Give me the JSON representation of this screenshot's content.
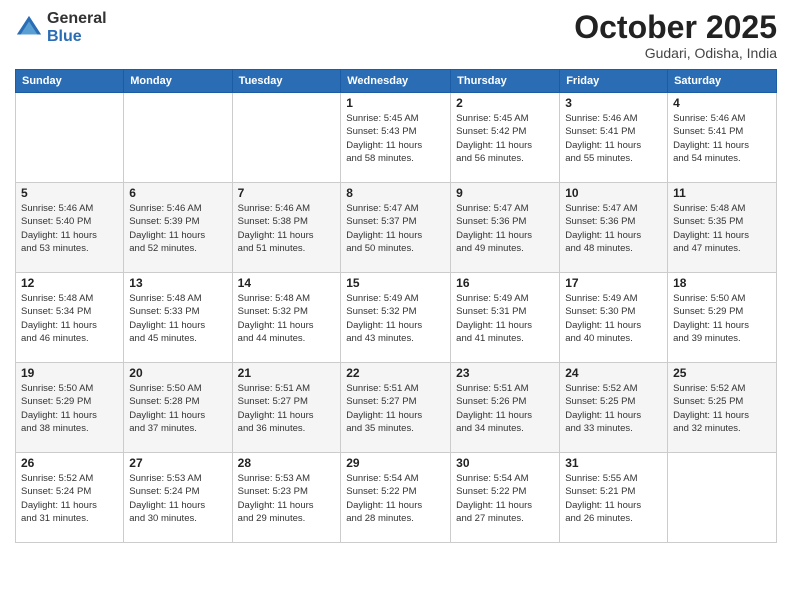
{
  "header": {
    "logo_general": "General",
    "logo_blue": "Blue",
    "month_title": "October 2025",
    "location": "Gudari, Odisha, India"
  },
  "weekdays": [
    "Sunday",
    "Monday",
    "Tuesday",
    "Wednesday",
    "Thursday",
    "Friday",
    "Saturday"
  ],
  "weeks": [
    [
      {
        "day": "",
        "info": ""
      },
      {
        "day": "",
        "info": ""
      },
      {
        "day": "",
        "info": ""
      },
      {
        "day": "1",
        "info": "Sunrise: 5:45 AM\nSunset: 5:43 PM\nDaylight: 11 hours\nand 58 minutes."
      },
      {
        "day": "2",
        "info": "Sunrise: 5:45 AM\nSunset: 5:42 PM\nDaylight: 11 hours\nand 56 minutes."
      },
      {
        "day": "3",
        "info": "Sunrise: 5:46 AM\nSunset: 5:41 PM\nDaylight: 11 hours\nand 55 minutes."
      },
      {
        "day": "4",
        "info": "Sunrise: 5:46 AM\nSunset: 5:41 PM\nDaylight: 11 hours\nand 54 minutes."
      }
    ],
    [
      {
        "day": "5",
        "info": "Sunrise: 5:46 AM\nSunset: 5:40 PM\nDaylight: 11 hours\nand 53 minutes."
      },
      {
        "day": "6",
        "info": "Sunrise: 5:46 AM\nSunset: 5:39 PM\nDaylight: 11 hours\nand 52 minutes."
      },
      {
        "day": "7",
        "info": "Sunrise: 5:46 AM\nSunset: 5:38 PM\nDaylight: 11 hours\nand 51 minutes."
      },
      {
        "day": "8",
        "info": "Sunrise: 5:47 AM\nSunset: 5:37 PM\nDaylight: 11 hours\nand 50 minutes."
      },
      {
        "day": "9",
        "info": "Sunrise: 5:47 AM\nSunset: 5:36 PM\nDaylight: 11 hours\nand 49 minutes."
      },
      {
        "day": "10",
        "info": "Sunrise: 5:47 AM\nSunset: 5:36 PM\nDaylight: 11 hours\nand 48 minutes."
      },
      {
        "day": "11",
        "info": "Sunrise: 5:48 AM\nSunset: 5:35 PM\nDaylight: 11 hours\nand 47 minutes."
      }
    ],
    [
      {
        "day": "12",
        "info": "Sunrise: 5:48 AM\nSunset: 5:34 PM\nDaylight: 11 hours\nand 46 minutes."
      },
      {
        "day": "13",
        "info": "Sunrise: 5:48 AM\nSunset: 5:33 PM\nDaylight: 11 hours\nand 45 minutes."
      },
      {
        "day": "14",
        "info": "Sunrise: 5:48 AM\nSunset: 5:32 PM\nDaylight: 11 hours\nand 44 minutes."
      },
      {
        "day": "15",
        "info": "Sunrise: 5:49 AM\nSunset: 5:32 PM\nDaylight: 11 hours\nand 43 minutes."
      },
      {
        "day": "16",
        "info": "Sunrise: 5:49 AM\nSunset: 5:31 PM\nDaylight: 11 hours\nand 41 minutes."
      },
      {
        "day": "17",
        "info": "Sunrise: 5:49 AM\nSunset: 5:30 PM\nDaylight: 11 hours\nand 40 minutes."
      },
      {
        "day": "18",
        "info": "Sunrise: 5:50 AM\nSunset: 5:29 PM\nDaylight: 11 hours\nand 39 minutes."
      }
    ],
    [
      {
        "day": "19",
        "info": "Sunrise: 5:50 AM\nSunset: 5:29 PM\nDaylight: 11 hours\nand 38 minutes."
      },
      {
        "day": "20",
        "info": "Sunrise: 5:50 AM\nSunset: 5:28 PM\nDaylight: 11 hours\nand 37 minutes."
      },
      {
        "day": "21",
        "info": "Sunrise: 5:51 AM\nSunset: 5:27 PM\nDaylight: 11 hours\nand 36 minutes."
      },
      {
        "day": "22",
        "info": "Sunrise: 5:51 AM\nSunset: 5:27 PM\nDaylight: 11 hours\nand 35 minutes."
      },
      {
        "day": "23",
        "info": "Sunrise: 5:51 AM\nSunset: 5:26 PM\nDaylight: 11 hours\nand 34 minutes."
      },
      {
        "day": "24",
        "info": "Sunrise: 5:52 AM\nSunset: 5:25 PM\nDaylight: 11 hours\nand 33 minutes."
      },
      {
        "day": "25",
        "info": "Sunrise: 5:52 AM\nSunset: 5:25 PM\nDaylight: 11 hours\nand 32 minutes."
      }
    ],
    [
      {
        "day": "26",
        "info": "Sunrise: 5:52 AM\nSunset: 5:24 PM\nDaylight: 11 hours\nand 31 minutes."
      },
      {
        "day": "27",
        "info": "Sunrise: 5:53 AM\nSunset: 5:24 PM\nDaylight: 11 hours\nand 30 minutes."
      },
      {
        "day": "28",
        "info": "Sunrise: 5:53 AM\nSunset: 5:23 PM\nDaylight: 11 hours\nand 29 minutes."
      },
      {
        "day": "29",
        "info": "Sunrise: 5:54 AM\nSunset: 5:22 PM\nDaylight: 11 hours\nand 28 minutes."
      },
      {
        "day": "30",
        "info": "Sunrise: 5:54 AM\nSunset: 5:22 PM\nDaylight: 11 hours\nand 27 minutes."
      },
      {
        "day": "31",
        "info": "Sunrise: 5:55 AM\nSunset: 5:21 PM\nDaylight: 11 hours\nand 26 minutes."
      },
      {
        "day": "",
        "info": ""
      }
    ]
  ]
}
